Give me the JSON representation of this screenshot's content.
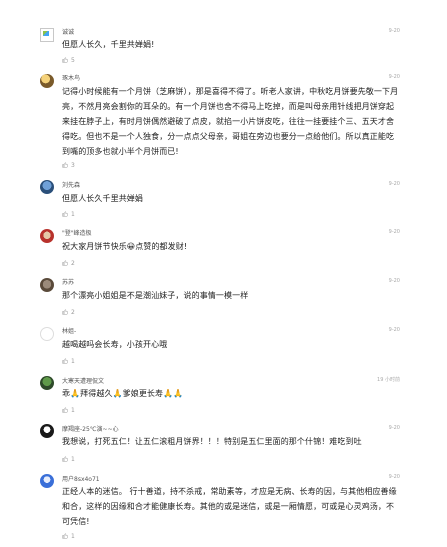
{
  "comments": [
    {
      "user": "诚诚",
      "time": "9-20",
      "text": "但愿人长久，千里共婵娟!",
      "likes": "5"
    },
    {
      "user": "琢木鸟",
      "time": "9-20",
      "text": "记得小时候能有一个月饼（芝麻饼），那是喜得不得了。听老人家讲，中秋吃月饼要先敬一下月亮，不然月亮会割你的耳朵的。有一个月饼也舍不得马上吃掉，而是叫母亲用针线把月饼穿起来挂在脖子上，有时月饼偶然避破了点皮，就掐一小片饼皮吃，往往一挂要挂个三、五天才舍得吃。但也不是一个人独食，分一点点父母亲，哥姐在旁边也要分一点给他们。所以真正能吃到嘴的顶多也就小半个月饼而已!",
      "likes": "3"
    },
    {
      "user": "刘先森",
      "time": "9-20",
      "text": "但愿人长久千里共婵娟",
      "likes": "1"
    },
    {
      "user": "\"登\"峰造极",
      "time": "9-20",
      "text": "祝大家月饼节快乐😀点赞的都发财!",
      "likes": "2"
    },
    {
      "user": "苏苏",
      "time": "9-20",
      "text": "那个漂亮小姐姐是不是潮汕妹子，说的事情一模一样",
      "likes": "2"
    },
    {
      "user": "林姐-",
      "time": "9-20",
      "text": "越喝越吗会长寿，小孩开心哦",
      "likes": "1"
    },
    {
      "user": "大寒天遭理侃文",
      "time": "19 小时前",
      "text": "乖🙏拜得越久🙏爹娘更长寿🙏🙏",
      "likes": "1"
    },
    {
      "user": "摩羯座-25℃演~~心",
      "time": "9-20",
      "text": "我想说，打死五仁！让五仁滚粗月饼界！！！特别是五仁里面的那个什锦！难吃到吐",
      "likes": "1"
    },
    {
      "user": "用户8sx4o71",
      "time": "9-20",
      "text": "正经人本的迷信。 行十善道，持不杀戒，常助素等，才应是无病、长寿的因，与其他相应善缘和合，这样的因缘和合才能健康长寿。其他的或是迷信，或是一厢情愿，可或是心灵鸡汤，不可凭信!",
      "likes": "1"
    }
  ],
  "icons": {
    "avatar": "user-avatar-icon",
    "like": "thumbs-up-icon"
  }
}
